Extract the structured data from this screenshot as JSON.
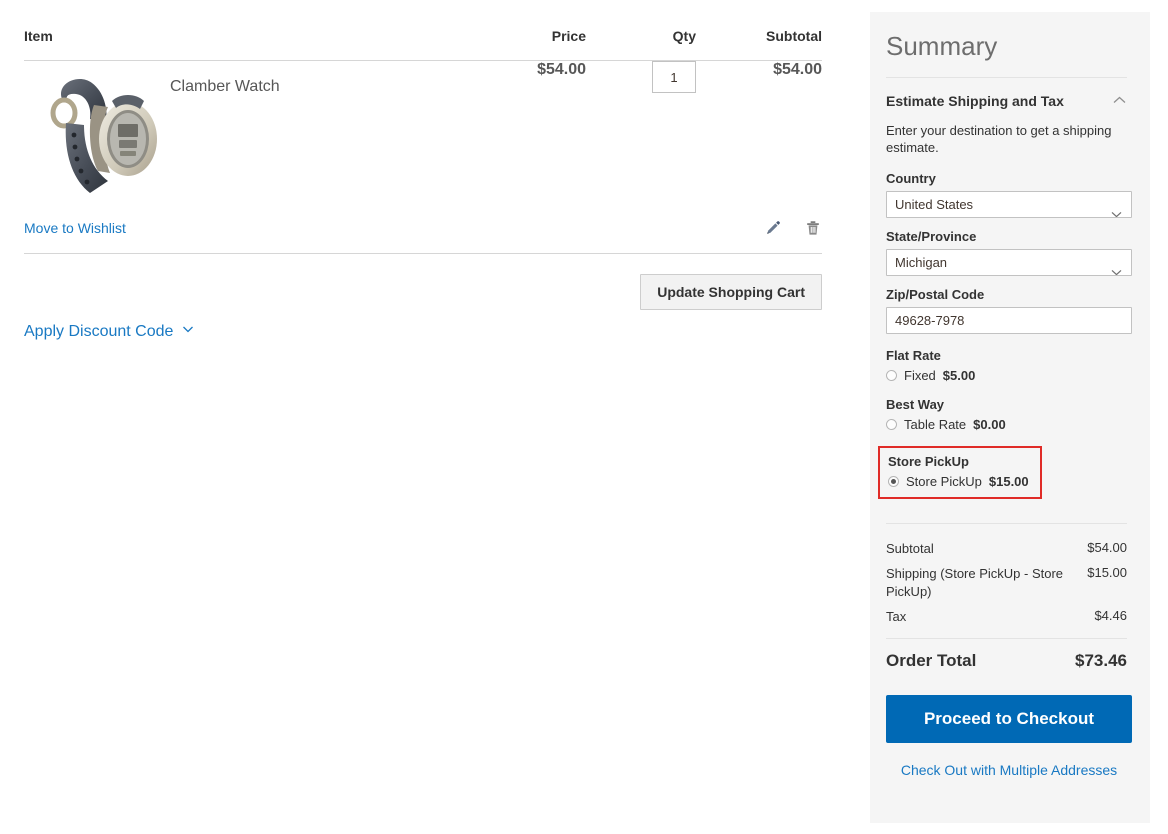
{
  "cart": {
    "columns": {
      "item": "Item",
      "price": "Price",
      "qty": "Qty",
      "subtotal": "Subtotal"
    },
    "rows": [
      {
        "name": "Clamber Watch",
        "image_alt": "clamber-watch-photo",
        "price": "$54.00",
        "qty": "1",
        "subtotal": "$54.00"
      }
    ],
    "move_to_wishlist": "Move to Wishlist",
    "edit_icon": "pencil-icon",
    "delete_icon": "trash-icon",
    "update_button": "Update Shopping Cart",
    "discount_title": "Apply Discount Code",
    "discount_caret": "chevron-down-icon"
  },
  "summary": {
    "title": "Summary",
    "estimate": {
      "heading": "Estimate Shipping and Tax",
      "toggle_icon": "chevron-up-icon",
      "note": "Enter your destination to get a shipping estimate.",
      "country_label": "Country",
      "country_value": "United States",
      "state_label": "State/Province",
      "state_value": "Michigan",
      "zip_label": "Zip/Postal Code",
      "zip_value": "49628-7978"
    },
    "shipping_methods": [
      {
        "carrier": "Flat Rate",
        "method": "Fixed",
        "price": "$5.00",
        "selected": false,
        "highlighted": false
      },
      {
        "carrier": "Best Way",
        "method": "Table Rate",
        "price": "$0.00",
        "selected": false,
        "highlighted": false
      },
      {
        "carrier": "Store PickUp",
        "method": "Store PickUp",
        "price": "$15.00",
        "selected": true,
        "highlighted": true
      }
    ],
    "totals": [
      {
        "label": "Subtotal",
        "value": "$54.00"
      },
      {
        "label": "Shipping (Store PickUp - Store PickUp)",
        "value": "$15.00"
      },
      {
        "label": "Tax",
        "value": "$4.46"
      }
    ],
    "order_total_label": "Order Total",
    "order_total_value": "$73.46",
    "checkout_button": "Proceed to Checkout",
    "multi_address_link": "Check Out with Multiple Addresses"
  },
  "colors": {
    "accent_link": "#1979c3",
    "checkout_blue": "#0069b5",
    "highlight_red": "#e02b27",
    "panel_bg": "#f5f5f5"
  }
}
